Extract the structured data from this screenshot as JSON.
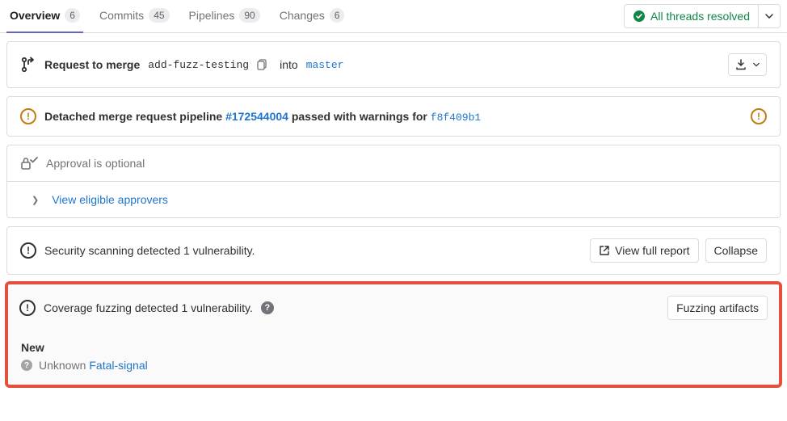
{
  "tabs": {
    "overview": {
      "label": "Overview",
      "count": "6"
    },
    "commits": {
      "label": "Commits",
      "count": "45"
    },
    "pipelines": {
      "label": "Pipelines",
      "count": "90"
    },
    "changes": {
      "label": "Changes",
      "count": "6"
    }
  },
  "threads": {
    "label": "All threads resolved"
  },
  "merge": {
    "request_label": "Request to merge",
    "source_branch": "add-fuzz-testing",
    "into_label": "into",
    "target_branch": "master"
  },
  "pipeline": {
    "prefix": "Detached merge request pipeline",
    "id": "#172544004",
    "status_text": "passed with warnings for",
    "sha": "f8f409b1"
  },
  "approval": {
    "text": "Approval is optional",
    "view_eligible": "View eligible approvers"
  },
  "security": {
    "summary": "Security scanning detected 1 vulnerability.",
    "view_report": "View full report",
    "collapse": "Collapse"
  },
  "fuzzing": {
    "summary": "Coverage fuzzing detected 1 vulnerability.",
    "artifacts_btn": "Fuzzing artifacts",
    "new_label": "New",
    "finding_severity": "Unknown",
    "finding_link": "Fatal-signal"
  }
}
